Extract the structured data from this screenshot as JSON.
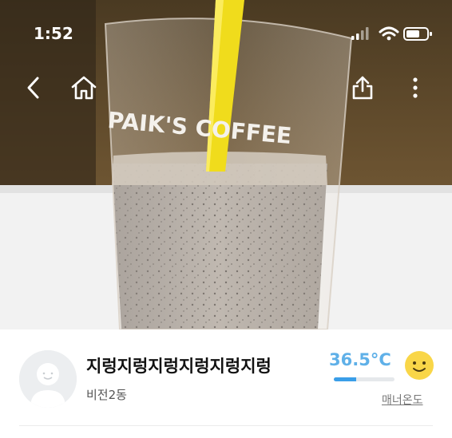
{
  "status_bar": {
    "time": "1:52"
  },
  "photo": {
    "cup_print": "PAIK'S COFFEE",
    "subject": "drink-in-cup"
  },
  "nav": {
    "icons": [
      "back-icon",
      "home-icon",
      "share-icon",
      "more-icon"
    ]
  },
  "profile": {
    "name": "지렁지렁지렁지렁지렁지렁",
    "region": "비전2동",
    "temperature": "36.5°C",
    "temperature_level": 0.365,
    "manner_label": "매너온도",
    "colors": {
      "temp": "#5fb0e8",
      "temp_bar": "#3a9ee8",
      "face": "#f9d648"
    }
  }
}
